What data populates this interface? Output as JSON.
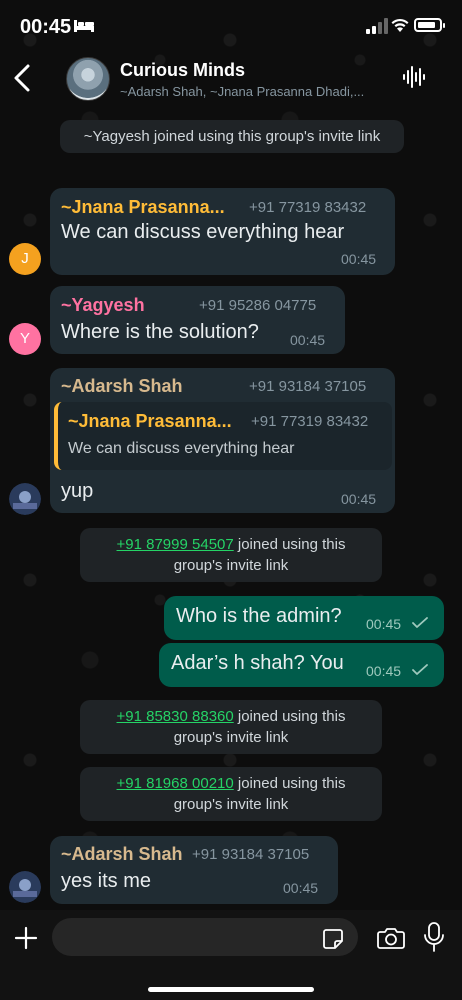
{
  "status": {
    "time": "00:45",
    "battery_level": 0.85
  },
  "header": {
    "group_name": "Curious Minds",
    "members": "~Adarsh Shah, ~Jnana Prasanna Dhadi,..."
  },
  "messages": {
    "sys1": "~Yagyesh joined using this group's invite link",
    "m1": {
      "sender": "~Jnana Prasanna...",
      "phone": "+91 77319 83432",
      "text": "We can discuss everything hear",
      "time": "00:45",
      "avatar_letter": "J"
    },
    "m2": {
      "sender": "~Yagyesh",
      "phone": "+91 95286 04775",
      "text": "Where is the solution?",
      "time": "00:45",
      "avatar_letter": "Y"
    },
    "m3": {
      "sender": "~Adarsh Shah",
      "phone": "+91 93184 37105",
      "quote_sender": "~Jnana Prasanna...",
      "quote_phone": "+91 77319 83432",
      "quote_text": "We can discuss everything hear",
      "text": "yup",
      "time": "00:45"
    },
    "sys2": {
      "link": "+91 87999 54507",
      "rest1": " joined using this",
      "rest2": "group's invite link"
    },
    "out1": {
      "text": "Who is the admin?",
      "time": "00:45"
    },
    "out2": {
      "text": "Adar’s h shah? You",
      "time": "00:45"
    },
    "sys3": {
      "link": "+91 85830 88360",
      "rest1": " joined using this",
      "rest2": "group's invite link"
    },
    "sys4": {
      "link": "+91 81968 00210",
      "rest1": " joined using this",
      "rest2": "group's invite link"
    },
    "m4": {
      "sender": "~Adarsh Shah",
      "phone": "+91 93184 37105",
      "text": "yes its me",
      "time": "00:45"
    }
  },
  "input": {
    "value": ""
  },
  "colors": {
    "jnana": "#ffbc38",
    "yagyesh": "#ff72a1",
    "adarsh": "#d7b98e",
    "link": "#25d366",
    "outgoing": "#005c4b"
  }
}
